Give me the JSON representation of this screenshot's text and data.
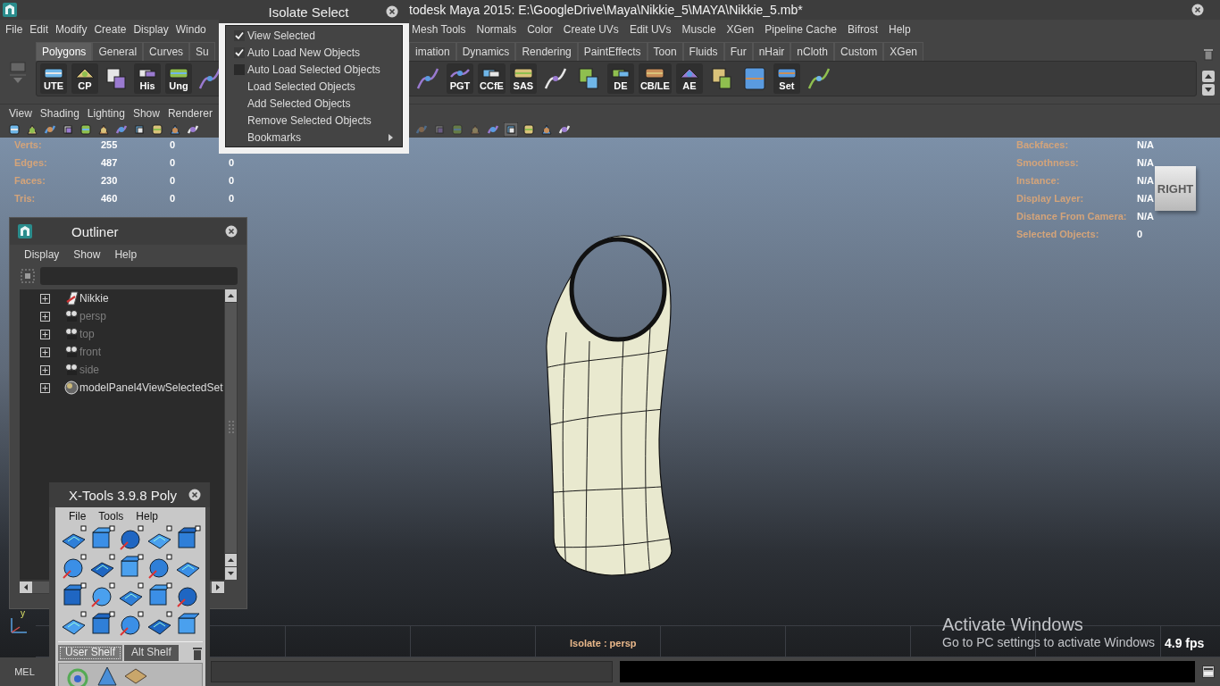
{
  "title_bar": {
    "title": "todesk Maya 2015: E:\\GoogleDrive\\Maya\\Nikkie_5\\MAYA\\Nikkie_5.mb*"
  },
  "main_menu": {
    "left": [
      "File",
      "Edit",
      "Modify",
      "Create",
      "Display",
      "Windo"
    ],
    "right": [
      "Mesh Tools",
      "Normals",
      "Color",
      "Create UVs",
      "Edit UVs",
      "Muscle",
      "XGen",
      "Pipeline Cache",
      "Bifrost",
      "Help"
    ]
  },
  "shelf": {
    "tabs_left": [
      {
        "label": "Polygons",
        "selected": true
      },
      {
        "label": "General",
        "selected": false
      },
      {
        "label": "Curves",
        "selected": false
      },
      {
        "label": "Su",
        "selected": false
      }
    ],
    "tabs_right": [
      {
        "label": "imation",
        "selected": false
      },
      {
        "label": "Dynamics",
        "selected": false
      },
      {
        "label": "Rendering",
        "selected": false
      },
      {
        "label": "PaintEffects",
        "selected": false
      },
      {
        "label": "Toon",
        "selected": false
      },
      {
        "label": "Fluids",
        "selected": false
      },
      {
        "label": "Fur",
        "selected": false
      },
      {
        "label": "nHair",
        "selected": false
      },
      {
        "label": "nCloth",
        "selected": false
      },
      {
        "label": "Custom",
        "selected": false
      },
      {
        "label": "XGen",
        "selected": false
      }
    ],
    "items_left": [
      {
        "kind": "labeled",
        "label": "UTE"
      },
      {
        "kind": "labeled",
        "label": "CP"
      },
      {
        "kind": "icon"
      },
      {
        "kind": "labeled",
        "label": "His"
      },
      {
        "kind": "labeled",
        "label": "Ung"
      },
      {
        "kind": "icon"
      }
    ],
    "items_right": [
      {
        "kind": "icon"
      },
      {
        "kind": "labeled",
        "label": "PGT"
      },
      {
        "kind": "labeled",
        "label": "CCfE"
      },
      {
        "kind": "labeled",
        "label": "SAS"
      },
      {
        "kind": "icon"
      },
      {
        "kind": "icon"
      },
      {
        "kind": "labeled",
        "label": "DE"
      },
      {
        "kind": "labeled",
        "label": "CB/LE"
      },
      {
        "kind": "labeled",
        "label": "AE"
      },
      {
        "kind": "icon"
      },
      {
        "kind": "icon"
      },
      {
        "kind": "labeled",
        "label": "Set"
      },
      {
        "kind": "icon"
      }
    ]
  },
  "panel_menu": [
    "View",
    "Shading",
    "Lighting",
    "Show",
    "Renderer"
  ],
  "viewport": {
    "hud_left": [
      {
        "label": "Verts:",
        "values": [
          "255",
          "0"
        ]
      },
      {
        "label": "Edges:",
        "values": [
          "487",
          "0",
          "0"
        ]
      },
      {
        "label": "Faces:",
        "values": [
          "230",
          "0",
          "0"
        ]
      },
      {
        "label": "Tris:",
        "values": [
          "460",
          "0",
          "0"
        ]
      }
    ],
    "hud_right": [
      {
        "label": "Backfaces:",
        "value": "N/A"
      },
      {
        "label": "Smoothness:",
        "value": "N/A"
      },
      {
        "label": "Instance:",
        "value": "N/A"
      },
      {
        "label": "Display Layer:",
        "value": "N/A"
      },
      {
        "label": "Distance From Camera:",
        "value": "N/A"
      },
      {
        "label": "Selected Objects:",
        "value": "0"
      }
    ],
    "view_cube": "RIGHT",
    "axis_label": "y",
    "isolate_status": "Isolate : persp",
    "fps": "4.9 fps",
    "activation_notice": {
      "title": "Activate Windows",
      "message": "Go to PC settings to activate Windows"
    }
  },
  "command_line": {
    "label": "MEL"
  },
  "isolate_select": {
    "title": "Isolate Select",
    "items": [
      {
        "label": "View Selected",
        "kind": "check",
        "checked": true
      },
      {
        "label": "Auto Load New Objects",
        "kind": "check",
        "checked": true
      },
      {
        "label": "Auto Load Selected Objects",
        "kind": "check",
        "checked": false
      },
      {
        "label": "Load Selected Objects",
        "kind": "item"
      },
      {
        "label": "Add Selected Objects",
        "kind": "item"
      },
      {
        "label": "Remove Selected Objects",
        "kind": "item"
      },
      {
        "label": "Bookmarks",
        "kind": "submenu"
      }
    ]
  },
  "outliner": {
    "title": "Outliner",
    "menu": [
      "Display",
      "Show",
      "Help"
    ],
    "items": [
      {
        "label": "Nikkie",
        "kind": "transform",
        "hidden": false
      },
      {
        "label": "persp",
        "kind": "camera",
        "hidden": true
      },
      {
        "label": "top",
        "kind": "camera",
        "hidden": true
      },
      {
        "label": "front",
        "kind": "camera",
        "hidden": true
      },
      {
        "label": "side",
        "kind": "camera",
        "hidden": true
      },
      {
        "label": "modelPanel4ViewSelectedSet",
        "kind": "set",
        "hidden": false
      }
    ]
  },
  "xtools": {
    "title": "X-Tools 3.9.8 Poly",
    "menu": [
      "File",
      "Tools",
      "Help"
    ],
    "shelf_tabs": [
      {
        "label": "User Shelf",
        "selected": true
      },
      {
        "label": "Alt Shelf",
        "selected": false
      }
    ]
  }
}
